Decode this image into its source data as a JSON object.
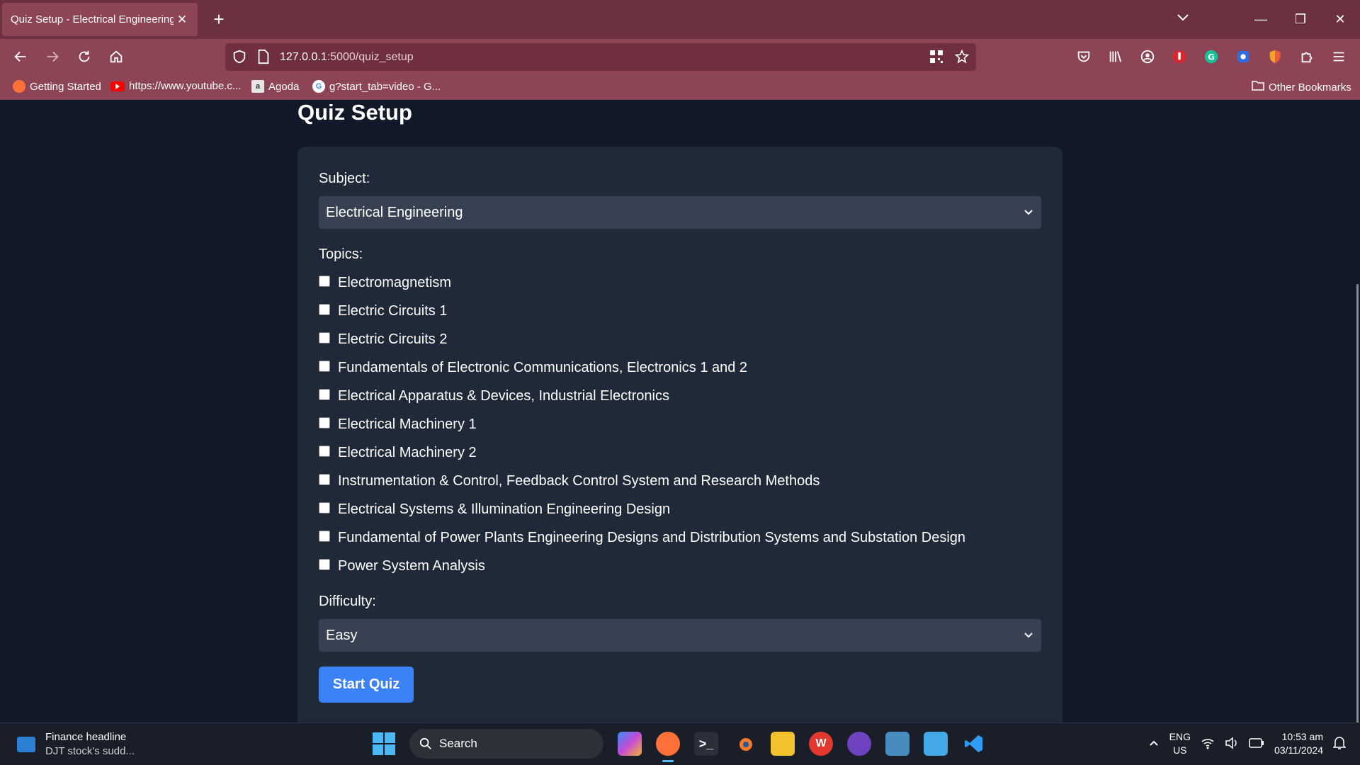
{
  "browser": {
    "tab_title": "Quiz Setup - Electrical Engineering",
    "url_host": "127.0.0.1",
    "url_path": ":5000/quiz_setup",
    "bookmarks": [
      "Getting Started",
      "https://www.youtube.c...",
      "Agoda",
      "g?start_tab=video - G..."
    ],
    "other_bookmarks": "Other Bookmarks"
  },
  "page": {
    "title": "Quiz Setup",
    "subject_label": "Subject:",
    "subject_value": "Electrical Engineering",
    "topics_label": "Topics:",
    "topics": [
      "Electromagnetism",
      "Electric Circuits 1",
      "Electric Circuits 2",
      "Fundamentals of Electronic Communications, Electronics 1 and 2",
      "Electrical Apparatus & Devices, Industrial Electronics",
      "Electrical Machinery 1",
      "Electrical Machinery 2",
      "Instrumentation & Control, Feedback Control System and Research Methods",
      "Electrical Systems & Illumination Engineering Design",
      "Fundamental of Power Plants Engineering Designs and Distribution Systems and Substation Design",
      "Power System Analysis"
    ],
    "difficulty_label": "Difficulty:",
    "difficulty_value": "Easy",
    "start_button": "Start Quiz"
  },
  "taskbar": {
    "news_title": "Finance headline",
    "news_sub": "DJT stock's sudd...",
    "search": "Search",
    "lang_1": "ENG",
    "lang_2": "US",
    "time": "10:53 am",
    "date": "03/11/2024"
  },
  "colors": {
    "tabbar": "#6c3140",
    "toolbar": "#8d4556",
    "page_bg": "#111827",
    "card_bg": "#1f2937",
    "select_bg": "#374151",
    "button": "#3b82f6"
  }
}
